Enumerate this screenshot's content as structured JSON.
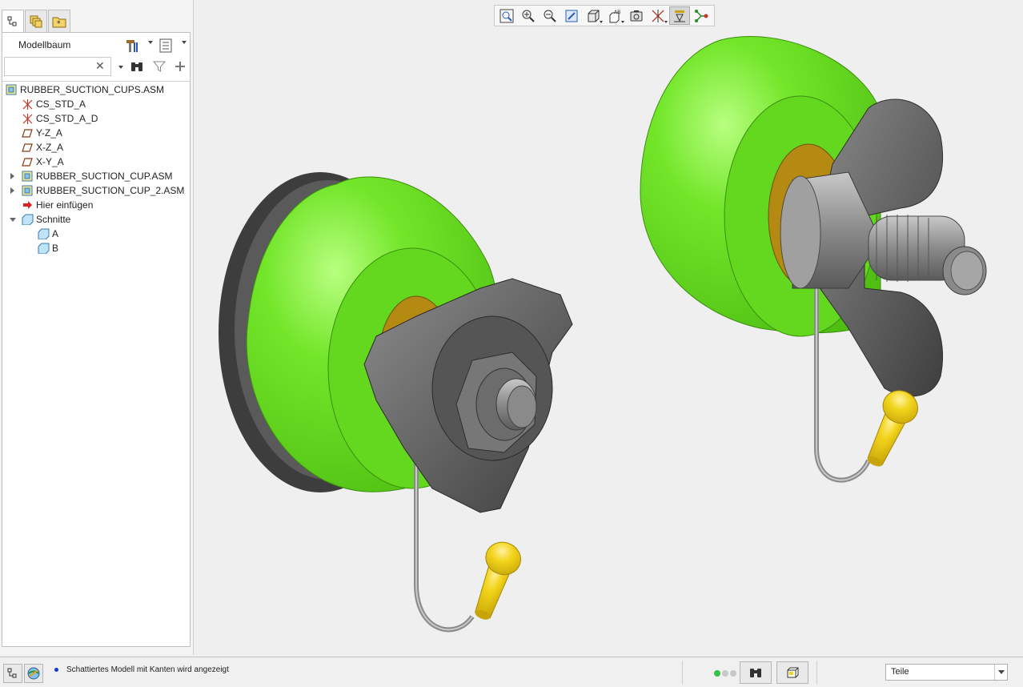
{
  "left_panel": {
    "tabs": [
      {
        "icon": "model-tree-icon"
      },
      {
        "icon": "layers-icon"
      },
      {
        "icon": "favorites-folder-icon"
      }
    ],
    "tree_title": "Modellbaum",
    "header_buttons": [
      {
        "icon": "settings-hammer-icon"
      },
      {
        "icon": "tree-list-icon"
      }
    ],
    "search": {
      "value": "",
      "placeholder": ""
    },
    "search_buttons": [
      {
        "icon": "binoculars-icon"
      },
      {
        "icon": "filter-icon"
      },
      {
        "icon": "plus-icon"
      }
    ],
    "tree": [
      {
        "label": "RUBBER_SUCTION_CUPS.ASM",
        "icon": "assembly-icon",
        "level": 0
      },
      {
        "label": "CS_STD_A",
        "icon": "coordinate-system-icon",
        "level": 1
      },
      {
        "label": "CS_STD_A_D",
        "icon": "coordinate-system-icon",
        "level": 1
      },
      {
        "label": "Y-Z_A",
        "icon": "datum-plane-icon",
        "level": 1
      },
      {
        "label": "X-Z_A",
        "icon": "datum-plane-icon",
        "level": 1
      },
      {
        "label": "X-Y_A",
        "icon": "datum-plane-icon",
        "level": 1
      },
      {
        "label": "RUBBER_SUCTION_CUP.ASM",
        "icon": "assembly-icon",
        "level": 1,
        "expandable": "collapsed"
      },
      {
        "label": "RUBBER_SUCTION_CUP_2.ASM",
        "icon": "assembly-icon",
        "level": 1,
        "expandable": "collapsed"
      },
      {
        "label": "Hier einfügen",
        "icon": "insert-here-arrow-icon",
        "level": 1
      },
      {
        "label": "Schnitte",
        "icon": "sections-icon",
        "level": 1,
        "expandable": "expanded"
      },
      {
        "label": "A",
        "icon": "section-icon",
        "level": 2
      },
      {
        "label": "B",
        "icon": "section-icon",
        "level": 2
      }
    ]
  },
  "view_toolbar": [
    {
      "icon": "refit-icon"
    },
    {
      "icon": "zoom-in-icon"
    },
    {
      "icon": "zoom-out-icon"
    },
    {
      "icon": "repaint-icon"
    },
    {
      "icon": "display-style-icon"
    },
    {
      "icon": "saved-orientations-icon"
    },
    {
      "icon": "view-manager-icon"
    },
    {
      "icon": "datum-display-icon"
    },
    {
      "icon": "annotation-display-icon",
      "active": true
    },
    {
      "icon": "spin-center-icon"
    }
  ],
  "status_bar": {
    "message": "Schattiertes Modell mit Kanten wird angezeigt",
    "filter_value": "Teile",
    "colors": {
      "indicator": "#33c24a",
      "dot": "#1a35c7"
    }
  },
  "model_colors": {
    "suction_cup": "#66e01c",
    "dark_metal": "#4a4a4a",
    "brass": "#b58a12",
    "knob": "#f0d21a",
    "background": "#efefef"
  }
}
